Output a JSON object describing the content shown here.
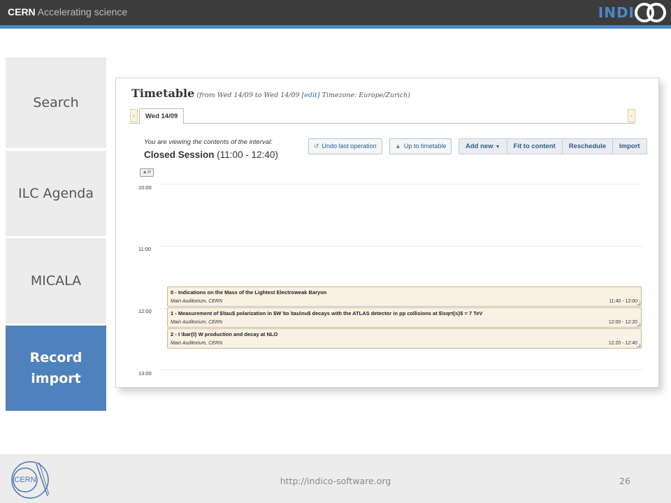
{
  "header": {
    "brand_bold": "CERN",
    "brand_tagline": " Accelerating science",
    "logo_prefix": "INDI",
    "logo_suffix": "CO",
    "accent_color": "#4a88c7"
  },
  "nav": {
    "items": [
      {
        "label": "Search",
        "active": false
      },
      {
        "label": "ILC Agenda",
        "active": false
      },
      {
        "label": "MICALA",
        "active": false
      },
      {
        "label": "Record import",
        "active": true
      }
    ],
    "active_color": "#4f81bd"
  },
  "timetable": {
    "title": "Timetable",
    "range_prefix": "(from Wed 14/09 to Wed 14/09 ",
    "edit_link": "[edit]",
    "range_suffix": " Timezone: Europe/Zurich)",
    "tab_label": "Wed 14/09",
    "interval_note": "You are viewing the contents of the interval:",
    "session_name": "Closed Session",
    "session_time": " (11:00 - 12:40)",
    "buttons": {
      "undo": "Undo last operation",
      "up": "Up to timetable",
      "add_new": "Add new",
      "fit": "Fit to content",
      "reschedule": "Reschedule",
      "import": "Import"
    },
    "hours": [
      "10:00",
      "11:00",
      "12:00",
      "13:00"
    ],
    "entries": [
      {
        "title": "0 - Indications on the Mass of the Lightest Electroweak Baryon",
        "location": "Main Auditorium, CERN",
        "time": "11:40 - 12:00"
      },
      {
        "title": "1 - Measurement of $\\tau$ polarization in $W \\to \\tau\\nu$ decays with the ATLAS detector in pp collisions at $\\sqrt{s}$ = 7 TeV",
        "location": "Main Auditorium, CERN",
        "time": "12:00 - 12:20"
      },
      {
        "title": "2 - t \\bar{t} W production and decay at NLO",
        "location": "Main Auditorium, CERN",
        "time": "12:20 - 12:40"
      }
    ],
    "entry_color": "#f9f1e4"
  },
  "footer": {
    "logo_text": "CERN",
    "url": "http://indico-software.org",
    "page_number": "26"
  }
}
